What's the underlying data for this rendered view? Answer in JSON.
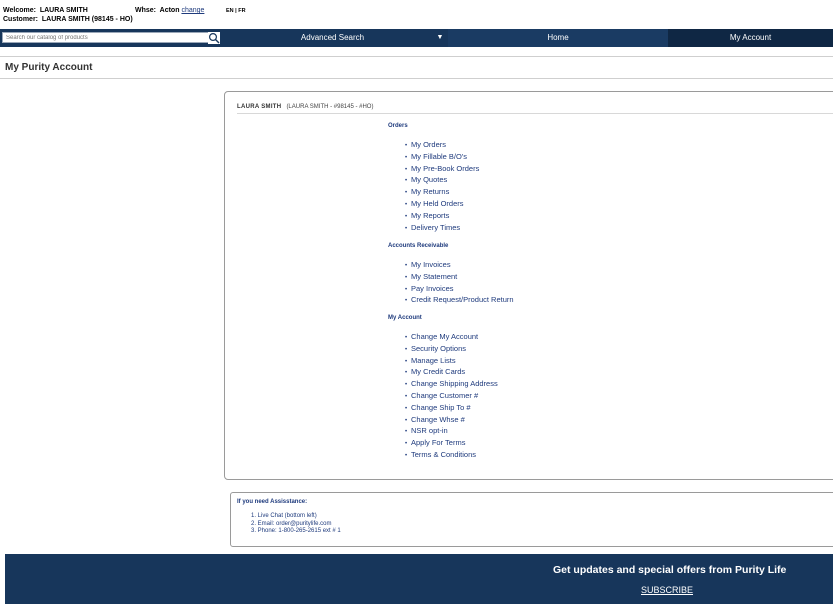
{
  "header": {
    "welcome_label": "Welcome:",
    "welcome_name": "LAURA SMITH",
    "customer_label": "Customer:",
    "customer_value": "LAURA SMITH  (98145 - HO)",
    "whse_label": "Whse:",
    "whse_value": "Acton",
    "change_link": "change",
    "lang_en": "EN",
    "lang_sep": "|",
    "lang_fr": "FR"
  },
  "nav": {
    "search_placeholder": "Search our catalog of products",
    "search_icon": "magnifier-icon",
    "advanced_search": "Advanced Search",
    "dropdown_glyph": "▼",
    "home": "Home",
    "my_account": "My Account"
  },
  "page": {
    "title": "My Purity Account"
  },
  "panel": {
    "customer_name": "LAURA SMITH",
    "customer_detail": "(LAURA SMITH - #98145 - #HO)",
    "sections": [
      {
        "title": "Orders",
        "items": [
          "My Orders",
          "My Fillable B/O's",
          "My Pre-Book Orders",
          "My Quotes",
          "My Returns",
          "My Held Orders",
          "My Reports",
          "Delivery Times"
        ]
      },
      {
        "title": "Accounts Receivable",
        "items": [
          "My Invoices",
          "My Statement",
          "Pay Invoices",
          "Credit Request/Product Return"
        ]
      },
      {
        "title": "My Account",
        "items": [
          "Change My Account",
          "Security Options",
          "Manage Lists",
          "My Credit Cards",
          "Change Shipping Address",
          "Change Customer #",
          "Change Ship To #",
          "Change Whse #",
          "NSR opt-in",
          "Apply For Terms",
          "Terms & Conditions"
        ]
      }
    ]
  },
  "assist": {
    "title": "If you need Assisstance:",
    "items": [
      "1. Live Chat (bottom left)",
      "2. Email:  order@puritylife.com",
      "3. Phone: 1-800-265-2615 ext # 1"
    ]
  },
  "footer": {
    "headline": "Get updates and special offers from Purity Life",
    "subscribe": "SUBSCRIBE"
  },
  "colors": {
    "nav_bg": "#17365b",
    "link": "#1f3b7d"
  }
}
